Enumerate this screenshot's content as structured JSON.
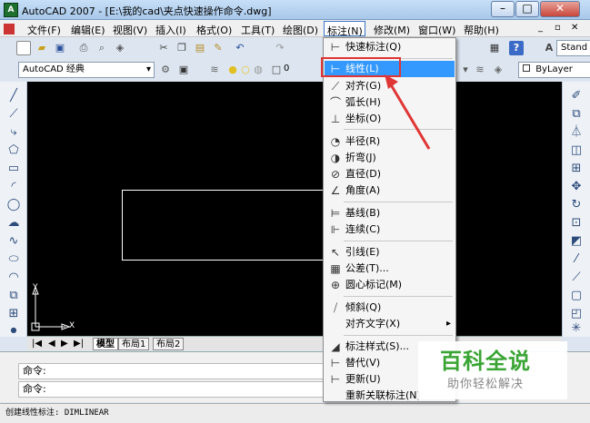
{
  "window": {
    "icon_text": "A",
    "title": "AutoCAD 2007 - [E:\\我的cad\\夹点快速操作命令.dwg]",
    "controls": [
      "–",
      "□",
      "✕"
    ]
  },
  "menubar": {
    "items": [
      "文件(F)",
      "编辑(E)",
      "视图(V)",
      "插入(I)",
      "格式(O)",
      "工具(T)",
      "绘图(D)",
      "标注(N)",
      "修改(M)",
      "窗口(W)",
      "帮助(H)"
    ],
    "active": "标注(N)",
    "doc_controls": [
      "_",
      "▫",
      "✕"
    ]
  },
  "toolbar1": {
    "icons": [
      "new-icon",
      "open-icon",
      "save-icon",
      "plot-icon",
      "preview-icon",
      "publish-icon",
      "cut-icon",
      "copy-icon",
      "paste-icon",
      "match-icon",
      "undo-icon",
      "redo-icon",
      "calc-icon",
      "help-icon",
      "text-style-icon"
    ],
    "text_style": "Stand"
  },
  "toolbar2": {
    "workspace": "AutoCAD 经典",
    "layer_value": "0",
    "linetype": "ByLayer"
  },
  "dimension_menu": {
    "items": [
      {
        "icon": "quick-dim-icon",
        "glyph": "⊢",
        "label": "快速标注(Q)"
      },
      {
        "icon": "linear-icon",
        "glyph": "⊢",
        "label": "线性(L)"
      },
      {
        "icon": "aligned-icon",
        "glyph": "⟋",
        "label": "对齐(G)"
      },
      {
        "icon": "arc-length-icon",
        "glyph": "⌒",
        "label": "弧长(H)"
      },
      {
        "icon": "ordinate-icon",
        "glyph": "⊥",
        "label": "坐标(O)"
      },
      {
        "icon": "radius-icon",
        "glyph": "◔",
        "label": "半径(R)"
      },
      {
        "icon": "jogged-icon",
        "glyph": "◑",
        "label": "折弯(J)"
      },
      {
        "icon": "diameter-icon",
        "glyph": "⊘",
        "label": "直径(D)"
      },
      {
        "icon": "angular-icon",
        "glyph": "∠",
        "label": "角度(A)"
      },
      {
        "icon": "baseline-icon",
        "glyph": "⊨",
        "label": "基线(B)"
      },
      {
        "icon": "continue-icon",
        "glyph": "⊩",
        "label": "连续(C)"
      },
      {
        "icon": "leader-icon",
        "glyph": "↖",
        "label": "引线(E)"
      },
      {
        "icon": "tolerance-icon",
        "glyph": "▦",
        "label": "公差(T)..."
      },
      {
        "icon": "center-mark-icon",
        "glyph": "⊕",
        "label": "圆心标记(M)"
      },
      {
        "icon": "oblique-icon",
        "glyph": "⧸",
        "label": "倾斜(Q)"
      },
      {
        "icon": "",
        "glyph": "",
        "label": "对齐文字(X)"
      },
      {
        "icon": "dim-style-icon",
        "glyph": "◢",
        "label": "标注样式(S)..."
      },
      {
        "icon": "override-icon",
        "glyph": "⊢",
        "label": "替代(V)"
      },
      {
        "icon": "update-icon",
        "glyph": "⊢",
        "label": "更新(U)"
      },
      {
        "icon": "",
        "glyph": "",
        "label": "重新关联标注(N)"
      }
    ],
    "highlighted": "线性(L)",
    "submenu_arrow": "▸"
  },
  "ucs": {
    "x_label": "X",
    "y_label": "Y"
  },
  "layout_tabs": {
    "nav": [
      "|◀",
      "◀",
      "▶",
      "▶|"
    ],
    "tabs": [
      "模型",
      "布局1",
      "布局2"
    ],
    "active": "模型"
  },
  "command": {
    "line1": "命令:",
    "line2": "命令:"
  },
  "status": {
    "text": "创建线性标注:  DIMLINEAR"
  },
  "watermark": {
    "title": "百科全说",
    "subtitle": "助你轻松解决"
  },
  "colors": {
    "highlight": "#3399ff",
    "annotation": "#e03535",
    "canvas": "#000000",
    "watermark_green": "#3aa534"
  }
}
